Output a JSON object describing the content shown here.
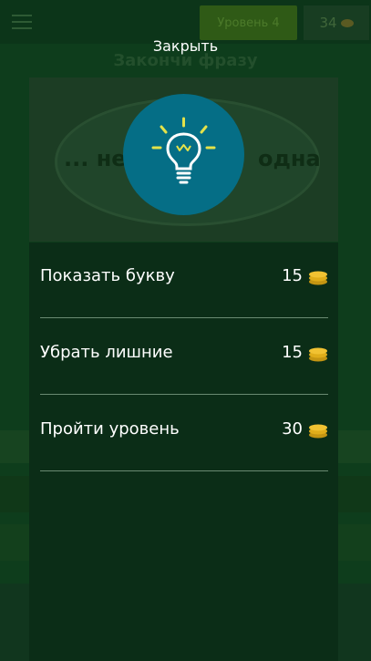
{
  "background": {
    "levels_button": "Уровень 4",
    "coins": "34",
    "title": "Закончи фразу",
    "phrase_left": "... не",
    "phrase_right": "одна"
  },
  "dialog": {
    "close_label": "Закрыть",
    "icon": "lightbulb-icon",
    "hints": [
      {
        "label": "Показать букву",
        "price": "15"
      },
      {
        "label": "Убрать лишние",
        "price": "15"
      },
      {
        "label": "Пройти уровень",
        "price": "30"
      }
    ]
  },
  "colors": {
    "panel": "#0b2d17",
    "icon_circle": "#056e86",
    "bulb": "#ffffff",
    "rays": "#e4e24a",
    "coin": "#f1c232"
  }
}
